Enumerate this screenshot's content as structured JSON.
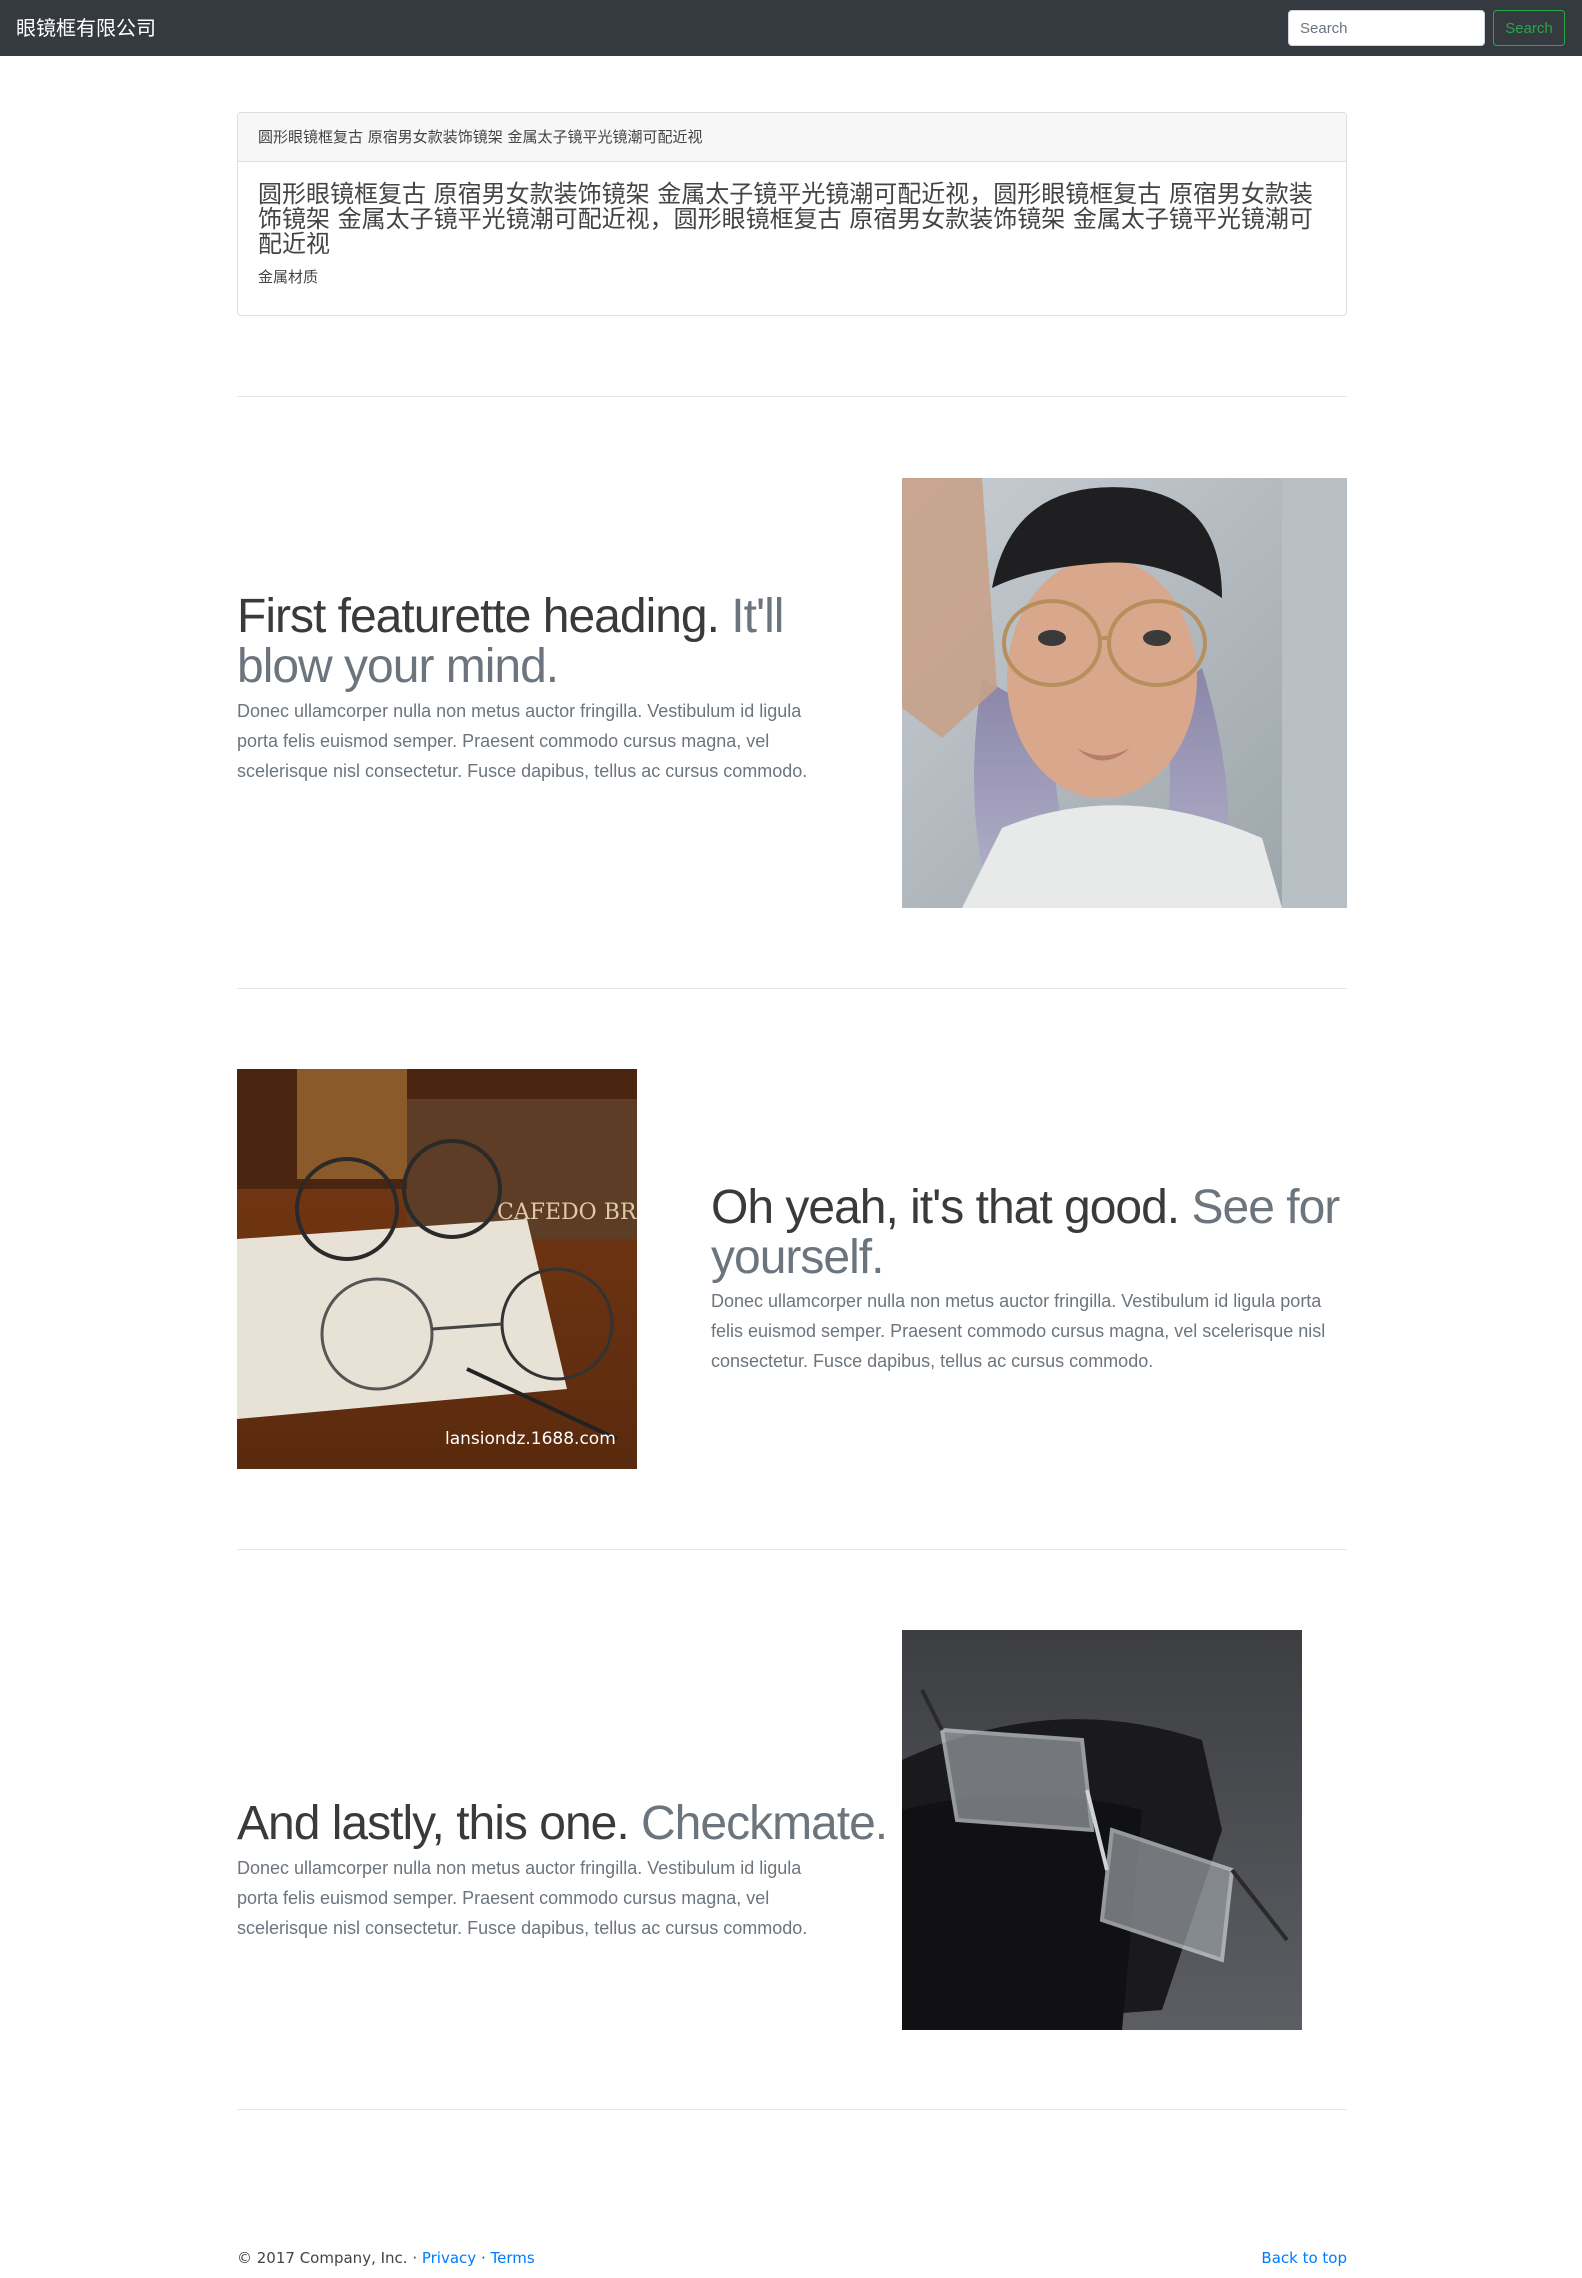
{
  "navbar": {
    "brand": "眼镜框有限公司",
    "search_placeholder": "Search",
    "search_button": "Search"
  },
  "card": {
    "header": "圆形眼镜框复古 原宿男女款装饰镜架 金属太子镜平光镜潮可配近视",
    "title": "圆形眼镜框复古 原宿男女款装饰镜架 金属太子镜平光镜潮可配近视，圆形眼镜框复古 原宿男女款装饰镜架 金属太子镜平光镜潮可配近视，圆形眼镜框复古 原宿男女款装饰镜架 金属太子镜平光镜潮可配近视",
    "text": "金属材质"
  },
  "featurettes": [
    {
      "heading": "First featurette heading.",
      "heading_muted": "It'll blow your mind.",
      "text": "Donec ullamcorper nulla non metus auctor fringilla. Vestibulum id ligula porta felis euismod semper. Praesent commodo cursus magna, vel scelerisque nisl consectetur. Fusce dapibus, tellus ac cursus commodo."
    },
    {
      "heading": "Oh yeah, it's that good.",
      "heading_muted": "See for yourself.",
      "text": "Donec ullamcorper nulla non metus auctor fringilla. Vestibulum id ligula porta felis euismod semper. Praesent commodo cursus magna, vel scelerisque nisl consectetur. Fusce dapibus, tellus ac cursus commodo.",
      "image_watermark": "lansiondz.1688.com"
    },
    {
      "heading": "And lastly, this one.",
      "heading_muted": "Checkmate.",
      "text": "Donec ullamcorper nulla non metus auctor fringilla. Vestibulum id ligula porta felis euismod semper. Praesent commodo cursus magna, vel scelerisque nisl consectetur. Fusce dapibus, tellus ac cursus commodo."
    }
  ],
  "footer": {
    "copyright": "© 2017 Company, Inc. · ",
    "privacy": "Privacy",
    "separator": " · ",
    "terms": "Terms",
    "back_to_top": "Back to top"
  }
}
